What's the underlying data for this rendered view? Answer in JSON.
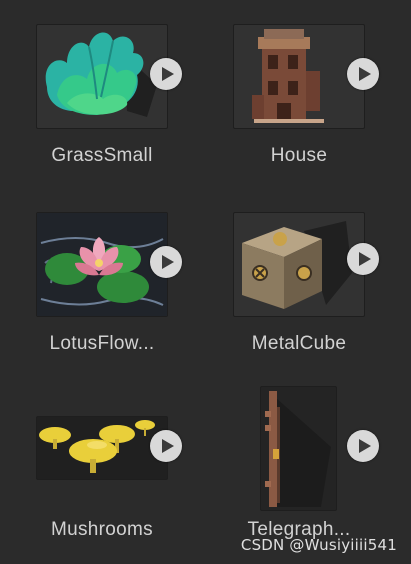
{
  "assets": [
    {
      "name": "GrassSmall",
      "icon": "grass-thumbnail"
    },
    {
      "name": "House",
      "icon": "house-thumbnail"
    },
    {
      "name": "LotusFlow...",
      "icon": "lotus-thumbnail"
    },
    {
      "name": "MetalCube",
      "icon": "metal-cube-thumbnail"
    },
    {
      "name": "Mushrooms",
      "icon": "mushrooms-thumbnail"
    },
    {
      "name": "Telegraph...",
      "icon": "telegraph-thumbnail"
    }
  ],
  "watermark": "CSDN @Wusiyiiii541",
  "colors": {
    "background": "#2b2b2b",
    "label": "#d2d2d2",
    "play_button": "#d9d9d9"
  }
}
